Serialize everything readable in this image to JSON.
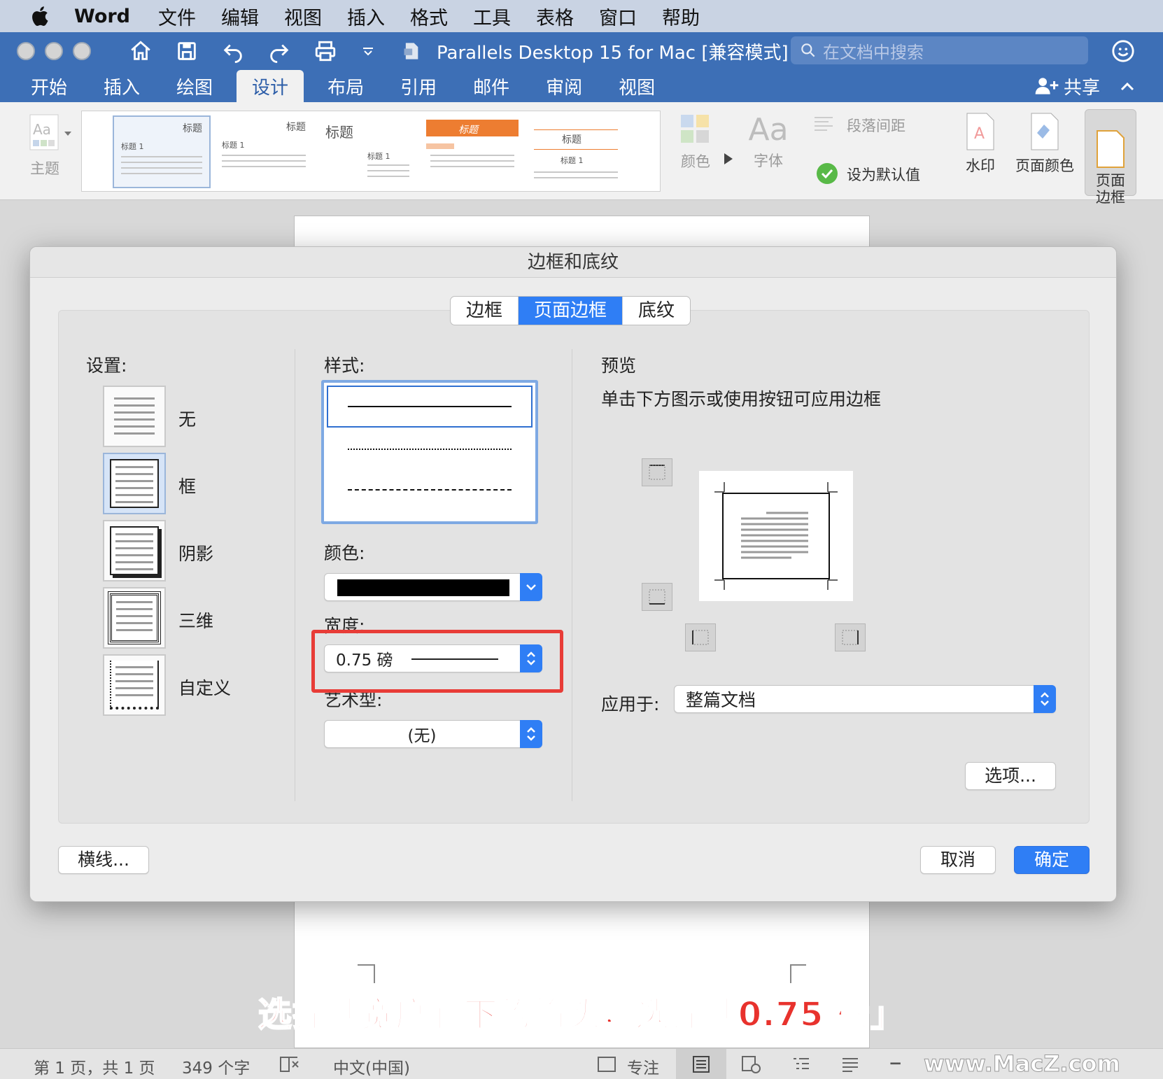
{
  "menubar": {
    "app": "Word",
    "items": [
      "文件",
      "编辑",
      "视图",
      "插入",
      "格式",
      "工具",
      "表格",
      "窗口",
      "帮助"
    ]
  },
  "titlebar": {
    "doc_title": "Parallels Desktop 15 for Mac [兼容模式]",
    "search_placeholder": "在文档中搜索"
  },
  "ribbon_tabs": [
    "开始",
    "插入",
    "绘图",
    "设计",
    "布局",
    "引用",
    "邮件",
    "审阅",
    "视图"
  ],
  "active_ribbon_tab": "设计",
  "share_label": "共享",
  "ribbon": {
    "theme_label": "主题",
    "gallery_heading": "标题",
    "gallery_sub": "标题 1",
    "colors_label": "颜色",
    "fonts_label": "字体",
    "paragraph_spacing_label": "段落间距",
    "set_default_label": "设为默认值",
    "watermark_label": "水印",
    "page_color_label": "页面颜色",
    "page_borders_label": "页面\n边框"
  },
  "dialog": {
    "title": "边框和底纹",
    "tabs": [
      "边框",
      "页面边框",
      "底纹"
    ],
    "active_tab": "页面边框",
    "settings_label": "设置:",
    "settings": [
      "无",
      "框",
      "阴影",
      "三维",
      "自定义"
    ],
    "selected_setting": "框",
    "style_label": "样式:",
    "color_label": "颜色:",
    "color_value": "#000000",
    "width_label": "宽度:",
    "width_value": "0.75 磅",
    "art_label": "艺术型:",
    "art_value": "(无)",
    "preview_label": "预览",
    "preview_hint": "单击下方图示或使用按钮可应用边框",
    "apply_to_label": "应用于:",
    "apply_to_value": "整篇文档",
    "options_button": "选项...",
    "horizontal_line_button": "横线...",
    "cancel_button": "取消",
    "ok_button": "确定"
  },
  "caption": "选择「宽度」下的箭头，选择「0.75 磅」",
  "statusbar": {
    "page_info": "第 1 页，共 1 页",
    "word_count": "349 个字",
    "language": "中文(中国)",
    "focus": "专注",
    "watermark_site": "www.MacZ.com"
  },
  "colors": {
    "accent": "#2f7ef5",
    "word_blue": "#3d6fb6",
    "highlight_red": "#e83c37"
  }
}
